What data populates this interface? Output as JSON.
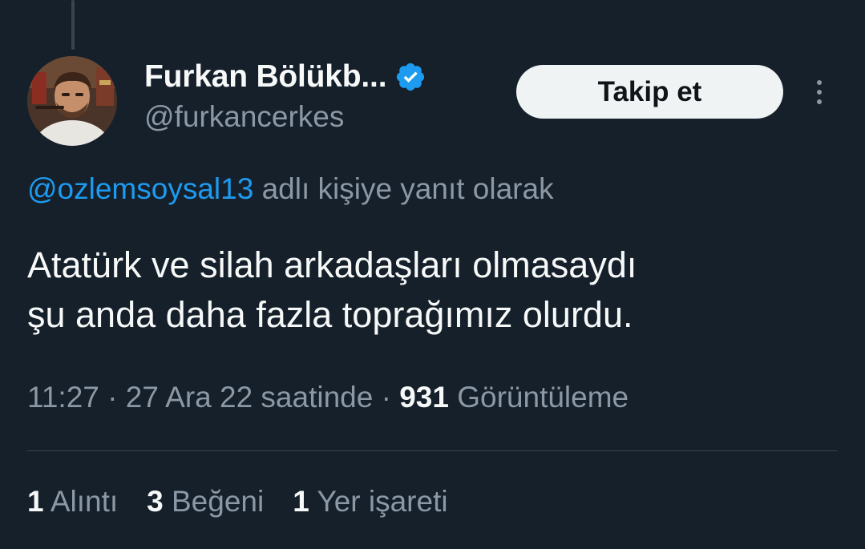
{
  "tweet": {
    "author": {
      "display_name": "Furkan Bölükb...",
      "handle": "@furkancerkes",
      "verified": true,
      "verified_color": "#1d9bf0"
    },
    "follow_button": {
      "label": "Takip et"
    },
    "more_menu_icon": "more-vertical-icon",
    "reply_context": {
      "mention": "@ozlemsoysal13",
      "suffix": " adlı kişiye yanıt olarak"
    },
    "text_lines": [
      "Atatürk ve silah arkadaşları olmasaydı",
      "şu anda daha fazla toprağımız olurdu."
    ],
    "meta": {
      "time": "11:27",
      "separator": " · ",
      "date": "27 Ara 22 saatinde",
      "views_count": "931",
      "views_label": " Görüntüleme"
    },
    "stats": [
      {
        "count": "1",
        "label": " Alıntı"
      },
      {
        "count": "3",
        "label": " Beğeni"
      },
      {
        "count": "1",
        "label": " Yer işareti"
      }
    ]
  },
  "theme": {
    "background": "#15202b",
    "primary_text": "#f7f9f9",
    "secondary_text": "#8b98a5",
    "accent": "#1d9bf0",
    "divider": "#38444d"
  }
}
